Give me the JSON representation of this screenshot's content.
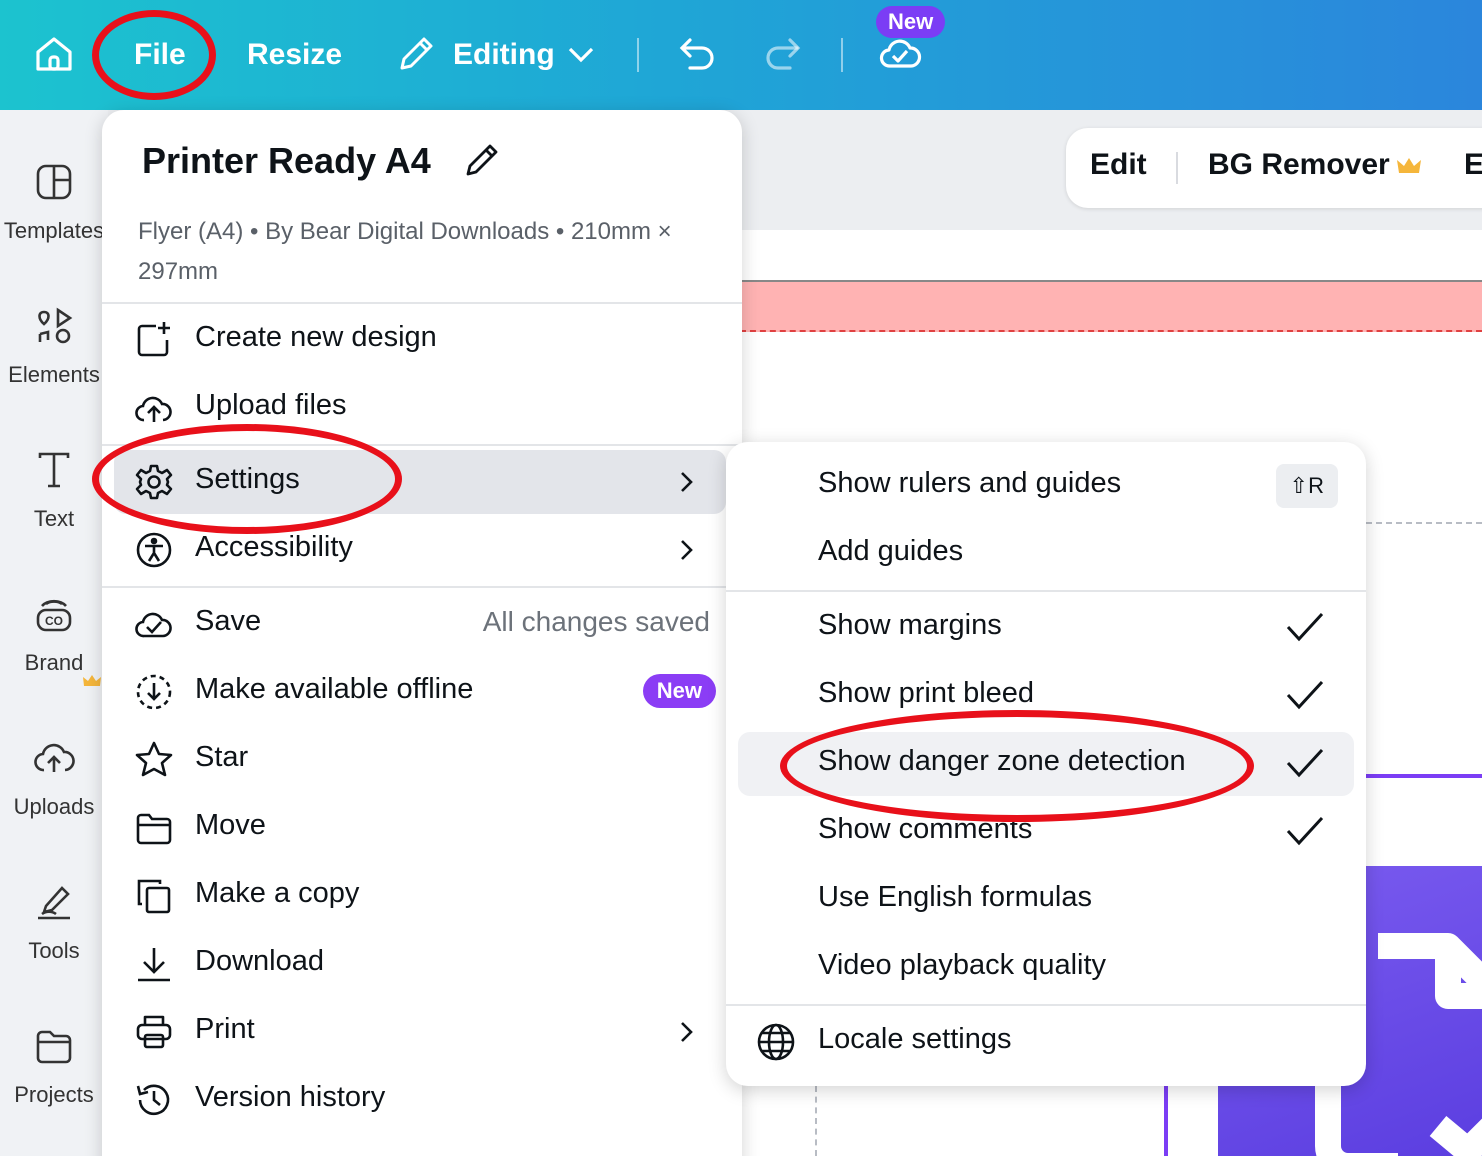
{
  "topbar": {
    "file_label": "File",
    "resize_label": "Resize",
    "editing_label": "Editing",
    "new_badge": "New",
    "icons": [
      "home-icon",
      "pencil-icon",
      "chevron-down-icon",
      "undo-icon",
      "redo-icon",
      "cloud-check-icon"
    ]
  },
  "rail": {
    "items": [
      {
        "label": "Templates",
        "icon": "templates-icon"
      },
      {
        "label": "Elements",
        "icon": "elements-icon"
      },
      {
        "label": "Text",
        "icon": "text-icon"
      },
      {
        "label": "Brand",
        "icon": "brand-icon"
      },
      {
        "label": "Uploads",
        "icon": "cloud-upload-icon"
      },
      {
        "label": "Tools",
        "icon": "tools-icon"
      },
      {
        "label": "Projects",
        "icon": "folder-icon"
      }
    ]
  },
  "toolbar": {
    "edit_label": "Edit",
    "bg_remover_label": "BG Remover",
    "cut_label": "E"
  },
  "file_menu": {
    "title": "Printer Ready A4",
    "subtitle": "Flyer (A4) • By Bear Digital Downloads • 210mm × 297mm",
    "items": [
      {
        "label": "Create new design",
        "icon": "add-design-icon"
      },
      {
        "label": "Upload files",
        "icon": "cloud-upload-icon"
      },
      {
        "label": "Settings",
        "icon": "gear-icon"
      },
      {
        "label": "Accessibility",
        "icon": "accessibility-icon"
      },
      {
        "label": "Save",
        "right": "All changes saved",
        "icon": "cloud-check-icon"
      },
      {
        "label": "Make available offline",
        "badge": "New",
        "icon": "offline-download-icon"
      },
      {
        "label": "Star",
        "icon": "star-icon"
      },
      {
        "label": "Move",
        "icon": "folder-icon"
      },
      {
        "label": "Make a copy",
        "icon": "copy-icon"
      },
      {
        "label": "Download",
        "icon": "download-icon"
      },
      {
        "label": "Print",
        "icon": "printer-icon"
      },
      {
        "label": "Version history",
        "icon": "history-icon"
      }
    ]
  },
  "settings_menu": {
    "items": [
      {
        "label": "Show rulers and guides",
        "shortcut": "⇧R",
        "checked": false
      },
      {
        "label": "Add guides",
        "checked": false
      },
      {
        "label": "Show margins",
        "checked": true
      },
      {
        "label": "Show print bleed",
        "checked": true
      },
      {
        "label": "Show danger zone detection",
        "checked": true
      },
      {
        "label": "Show comments",
        "checked": true
      },
      {
        "label": "Use English formulas",
        "checked": false
      },
      {
        "label": "Video playback quality",
        "checked": false
      },
      {
        "label": "Locale settings",
        "icon": "globe-icon"
      }
    ]
  },
  "colors": {
    "topbar_start": "#1cc3cf",
    "topbar_end": "#2b86dc",
    "accent_purple": "#7b3df5",
    "annotation_red": "#e8101a",
    "danger_zone": "#ffb3b3"
  }
}
